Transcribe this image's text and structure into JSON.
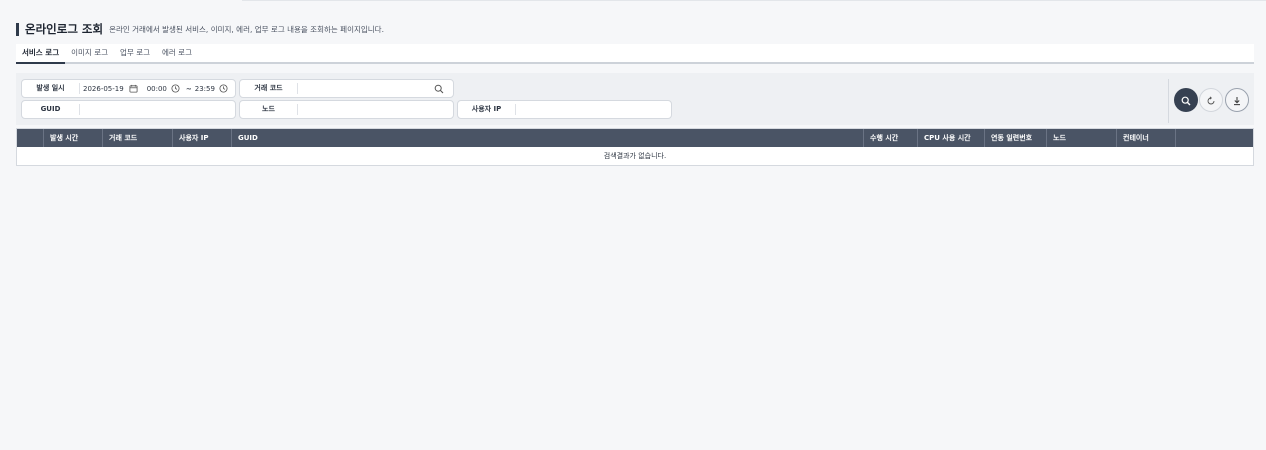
{
  "header": {
    "title": "온라인로그 조회",
    "description": "온라인 거래에서 발생된 서비스, 이미지, 에러, 업무 로그 내용을 조회하는 페이지입니다."
  },
  "tabs": [
    {
      "label": "서비스 로그",
      "active": true
    },
    {
      "label": "이미지 로그",
      "active": false
    },
    {
      "label": "업무 로그",
      "active": false
    },
    {
      "label": "에러 로그",
      "active": false
    }
  ],
  "search": {
    "occurred_at": {
      "label": "발생 일시",
      "date": "2026-05-19",
      "time_from": "00:00",
      "separator": "~",
      "time_to": "23:59"
    },
    "tx_code": {
      "label": "거래 코드",
      "value": ""
    },
    "guid": {
      "label": "GUID",
      "value": ""
    },
    "node": {
      "label": "노드",
      "value": ""
    },
    "user_ip": {
      "label": "사용자 IP",
      "value": ""
    }
  },
  "actions": {
    "search_icon": "search-icon",
    "reset_icon": "refresh-icon",
    "download_icon": "download-icon"
  },
  "table": {
    "columns": [
      "",
      "발생 시간",
      "거래 코드",
      "사용자 IP",
      "GUID",
      "수행 시간",
      "CPU 사용 시간",
      "연동 일련번호",
      "노드",
      "컨테이너",
      ""
    ],
    "empty_message": "검색결과가 없습니다."
  },
  "colors": {
    "accent": "#364152",
    "table_header": "#4a5465",
    "panel": "#eef0f3"
  }
}
